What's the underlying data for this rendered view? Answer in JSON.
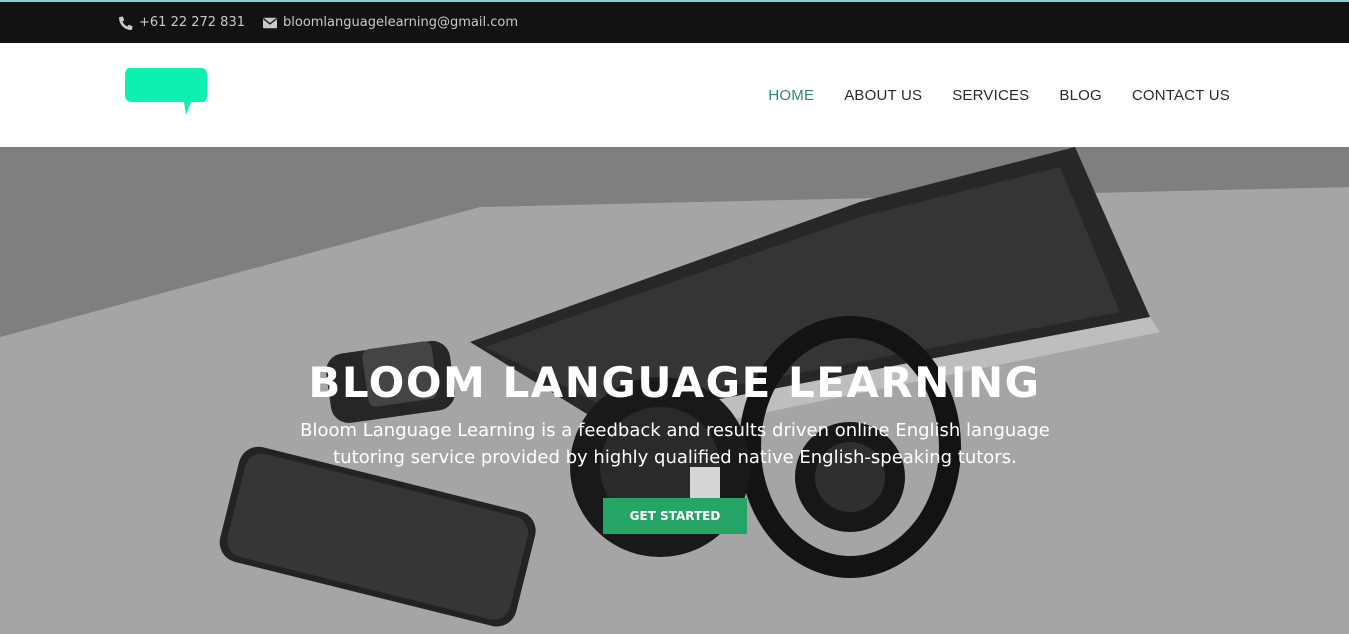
{
  "topbar": {
    "phone": "+61 22 272 831",
    "email": "bloomlanguagelearning@gmail.com",
    "phone_icon": "phone-icon",
    "email_icon": "envelope-icon"
  },
  "logo": {
    "icon": "speech-bubble-logo",
    "color": "#0ef0b0"
  },
  "nav": {
    "items": [
      {
        "label": "HOME",
        "active": true
      },
      {
        "label": "ABOUT US"
      },
      {
        "label": "SERVICES"
      },
      {
        "label": "BLOG"
      },
      {
        "label": "CONTACT US"
      }
    ],
    "active_color": "#2f8a5f"
  },
  "hero": {
    "title": "BLOOM LANGUAGE LEARNING",
    "subtitle": "Bloom Language Learning is a feedback and results driven online English language tutoring service provided by highly qualified native English-speaking tutors.",
    "cta_label": "GET STARTED",
    "cta_color": "#25a565"
  }
}
